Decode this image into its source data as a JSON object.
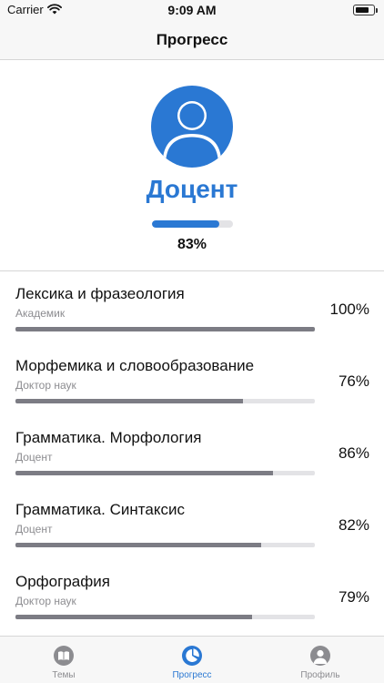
{
  "status_bar": {
    "carrier": "Carrier",
    "time": "9:09 AM",
    "battery_level": 0.8
  },
  "nav": {
    "title": "Прогресс"
  },
  "profile": {
    "rank": "Доцент",
    "overall_percent_label": "83%",
    "overall_progress": 0.83
  },
  "topics": [
    {
      "name": "Лексика и фразеология",
      "level": "Академик",
      "percent_label": "100%",
      "progress": 1.0
    },
    {
      "name": "Морфемика и словообразование",
      "level": "Доктор наук",
      "percent_label": "76%",
      "progress": 0.76
    },
    {
      "name": "Грамматика. Морфология",
      "level": "Доцент",
      "percent_label": "86%",
      "progress": 0.86
    },
    {
      "name": "Грамматика. Синтаксис",
      "level": "Доцент",
      "percent_label": "82%",
      "progress": 0.82
    },
    {
      "name": "Орфография",
      "level": "Доктор наук",
      "percent_label": "79%",
      "progress": 0.79
    }
  ],
  "tabs": [
    {
      "label": "Темы",
      "icon": "book-icon",
      "active": false
    },
    {
      "label": "Прогресс",
      "icon": "pie-chart-icon",
      "active": true
    },
    {
      "label": "Профиль",
      "icon": "person-icon",
      "active": false
    }
  ],
  "colors": {
    "accent": "#2a78d3",
    "bar": "#7c7c84",
    "track": "#e3e3e6",
    "inactive": "#8c8c90"
  }
}
